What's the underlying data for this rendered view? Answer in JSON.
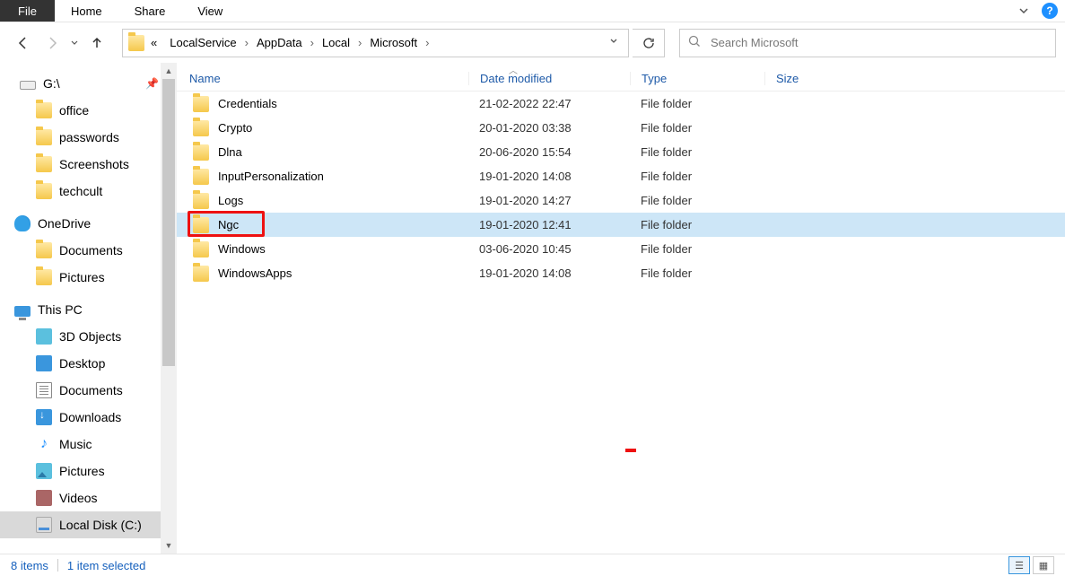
{
  "ribbon": {
    "file": "File",
    "home": "Home",
    "share": "Share",
    "view": "View"
  },
  "breadcrumb": {
    "ellipsis": "«",
    "parts": [
      "LocalService",
      "AppData",
      "Local",
      "Microsoft"
    ]
  },
  "search": {
    "placeholder": "Search Microsoft"
  },
  "sidebar": {
    "gdrive": "G:\\",
    "quick": [
      "office",
      "passwords",
      "Screenshots",
      "techcult"
    ],
    "onedrive": "OneDrive",
    "onedrive_items": [
      "Documents",
      "Pictures"
    ],
    "thispc": "This PC",
    "pc_items": [
      "3D Objects",
      "Desktop",
      "Documents",
      "Downloads",
      "Music",
      "Pictures",
      "Videos",
      "Local Disk (C:)"
    ]
  },
  "columns": {
    "name": "Name",
    "date": "Date modified",
    "type": "Type",
    "size": "Size"
  },
  "files": [
    {
      "name": "Credentials",
      "date": "21-02-2022 22:47",
      "type": "File folder"
    },
    {
      "name": "Crypto",
      "date": "20-01-2020 03:38",
      "type": "File folder"
    },
    {
      "name": "Dlna",
      "date": "20-06-2020 15:54",
      "type": "File folder"
    },
    {
      "name": "InputPersonalization",
      "date": "19-01-2020 14:08",
      "type": "File folder"
    },
    {
      "name": "Logs",
      "date": "19-01-2020 14:27",
      "type": "File folder"
    },
    {
      "name": "Ngc",
      "date": "19-01-2020 12:41",
      "type": "File folder",
      "selected": true,
      "highlighted": true
    },
    {
      "name": "Windows",
      "date": "03-06-2020 10:45",
      "type": "File folder"
    },
    {
      "name": "WindowsApps",
      "date": "19-01-2020 14:08",
      "type": "File folder"
    }
  ],
  "status": {
    "items": "8 items",
    "selected": "1 item selected"
  }
}
